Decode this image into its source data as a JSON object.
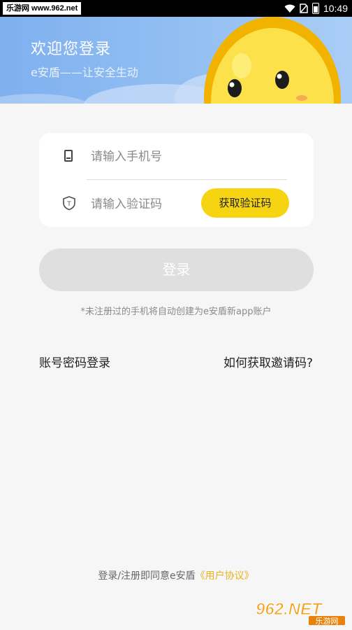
{
  "status_bar": {
    "watermark": "乐游网 www.962.net",
    "time": "10:49"
  },
  "header": {
    "title": "欢迎您登录",
    "slogan": "e安盾——让安全生动"
  },
  "form": {
    "phone_placeholder": "请输入手机号",
    "code_placeholder": "请输入验证码",
    "get_code_label": "获取验证码"
  },
  "login_label": "登录",
  "notice": "*未注册过的手机将自动创建为e安盾新app账户",
  "links": {
    "password_login": "账号密码登录",
    "how_get_invite": "如何获取邀请码?"
  },
  "agreement": {
    "prefix": "登录/注册即同意e安盾",
    "link": "《用户协议》"
  },
  "watermark_logo": {
    "brand": "962.NET",
    "site": "乐游网"
  },
  "colors": {
    "header_blue": "#8cbaf1",
    "accent_yellow": "#f6d412",
    "link_yellow": "#e7b31f",
    "disabled_gray": "#dfdfdf"
  }
}
